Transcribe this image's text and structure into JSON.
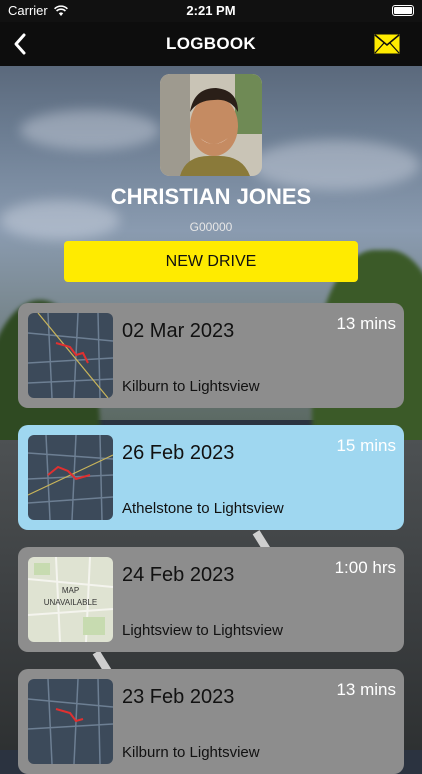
{
  "status": {
    "carrier": "Carrier",
    "time": "2:21 PM"
  },
  "nav": {
    "title": "LOGBOOK"
  },
  "profile": {
    "name": "CHRISTIAN JONES",
    "code": "G00000"
  },
  "actions": {
    "new_drive": "NEW DRIVE"
  },
  "drives": [
    {
      "date": "02 Mar 2023",
      "duration": "13 mins",
      "route": "Kilburn to Lightsview",
      "map": "map"
    },
    {
      "date": "26 Feb 2023",
      "duration": "15 mins",
      "route": "Athelstone to Lightsview",
      "map": "map",
      "selected": true
    },
    {
      "date": "24 Feb 2023",
      "duration": "1:00 hrs",
      "route": "Lightsview to Lightsview",
      "map": "unavailable",
      "map_text_line1": "MAP",
      "map_text_line2": "UNAVAILABLE"
    },
    {
      "date": "23 Feb 2023",
      "duration": "13 mins",
      "route": "Kilburn to Lightsview",
      "map": "map"
    }
  ],
  "colors": {
    "accent": "#ffeb00",
    "selected_card": "#9fd7f0",
    "card": "#8d8d8d",
    "nav": "#0d0d0d"
  }
}
